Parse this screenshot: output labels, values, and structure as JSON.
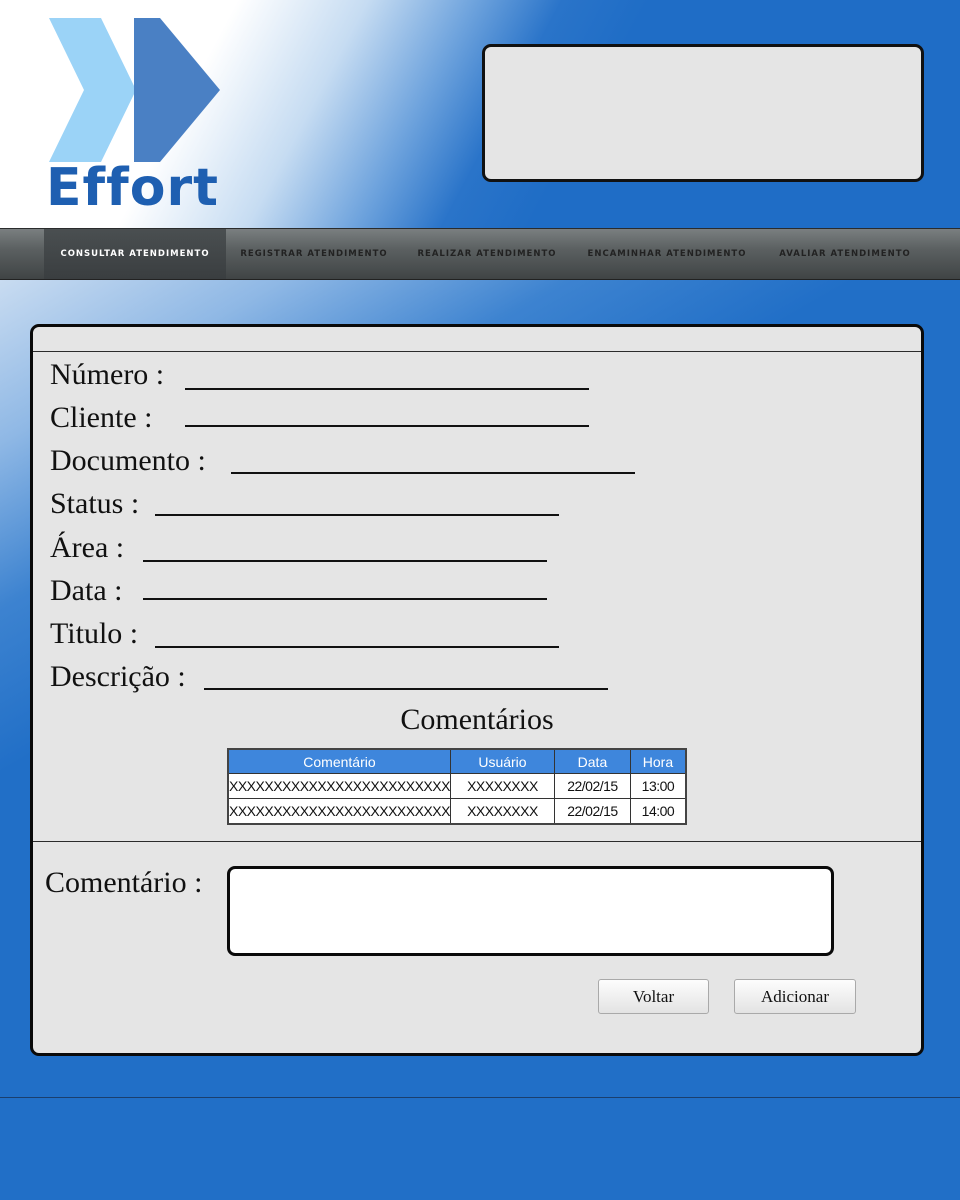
{
  "header": {
    "logo_text": "Effort",
    "colors": {
      "logo_chevron_light": "#9bd3f7",
      "logo_chevron_dark": "#4a80c4",
      "logo_text": "#1e5fb1"
    }
  },
  "nav": {
    "items": [
      {
        "label": "CONSULTAR ATENDIMENTO",
        "active": true
      },
      {
        "label": "REGISTRAR ATENDIMENTO",
        "active": false
      },
      {
        "label": "REALIZAR ATENDIMENTO",
        "active": false
      },
      {
        "label": "ENCAMINHAR ATENDIMENTO",
        "active": false
      },
      {
        "label": "AVALIAR ATENDIMENTO",
        "active": false
      }
    ]
  },
  "form": {
    "fields": [
      {
        "label": "Número :",
        "value": ""
      },
      {
        "label": "Cliente :",
        "value": ""
      },
      {
        "label": "Documento :",
        "value": ""
      },
      {
        "label": "Status :",
        "value": ""
      },
      {
        "label": "Área :",
        "value": ""
      },
      {
        "label": "Data :",
        "value": ""
      },
      {
        "label": "Titulo :",
        "value": ""
      },
      {
        "label": "Descrição :",
        "value": ""
      }
    ]
  },
  "comments": {
    "title": "Comentários",
    "columns": [
      "Comentário",
      "Usuário",
      "Data",
      "Hora"
    ],
    "rows": [
      [
        "XXXXXXXXXXXXXXXXXXXXXXXXX",
        "XXXXXXXX",
        "22/02/15",
        "13:00"
      ],
      [
        "XXXXXXXXXXXXXXXXXXXXXXXXX",
        "XXXXXXXX",
        "22/02/15",
        "14:00"
      ]
    ]
  },
  "new_comment": {
    "label": "Comentário :",
    "value": ""
  },
  "buttons": {
    "back": "Voltar",
    "add": "Adicionar"
  }
}
